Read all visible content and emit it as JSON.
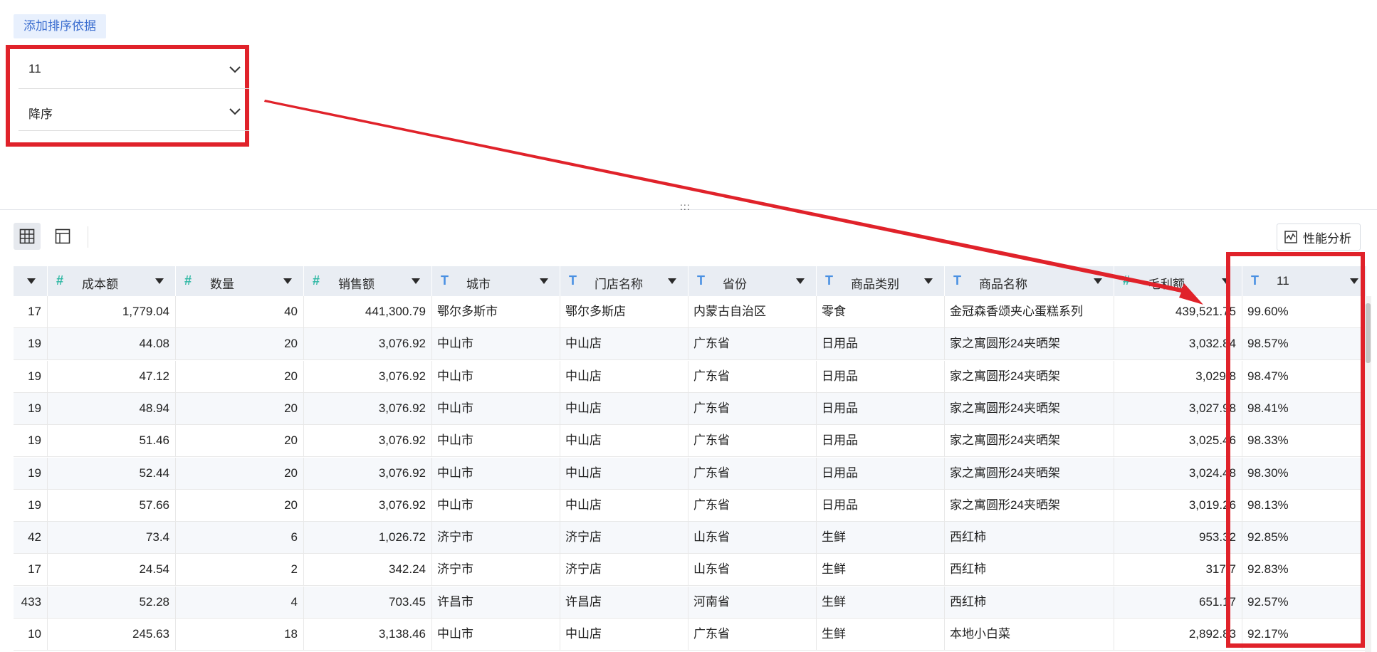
{
  "sort_panel": {
    "add_sort_label": "添加排序依据",
    "field_value": "11",
    "order_value": "降序"
  },
  "toolbar": {
    "drag_handle": ":::",
    "perf_label": "性能分析"
  },
  "table": {
    "columns": [
      {
        "label": "",
        "type": ""
      },
      {
        "label": "成本额",
        "type": "num"
      },
      {
        "label": "数量",
        "type": "num"
      },
      {
        "label": "销售额",
        "type": "num"
      },
      {
        "label": "城市",
        "type": "text"
      },
      {
        "label": "门店名称",
        "type": "text"
      },
      {
        "label": "省份",
        "type": "text"
      },
      {
        "label": "商品类别",
        "type": "text"
      },
      {
        "label": "商品名称",
        "type": "text"
      },
      {
        "label": "毛利额",
        "type": "num"
      },
      {
        "label": "11",
        "type": "text"
      }
    ],
    "type_glyphs": {
      "num": "#",
      "text": "T"
    },
    "rows": [
      [
        "17",
        "1,779.04",
        "40",
        "441,300.79",
        "鄂尔多斯市",
        "鄂尔多斯店",
        "内蒙古自治区",
        "零食",
        "金冠森香颂夹心蛋糕系列",
        "439,521.75",
        "99.60%"
      ],
      [
        "19",
        "44.08",
        "20",
        "3,076.92",
        "中山市",
        "中山店",
        "广东省",
        "日用品",
        "家之寓圆形24夹晒架",
        "3,032.84",
        "98.57%"
      ],
      [
        "19",
        "47.12",
        "20",
        "3,076.92",
        "中山市",
        "中山店",
        "广东省",
        "日用品",
        "家之寓圆形24夹晒架",
        "3,029.8",
        "98.47%"
      ],
      [
        "19",
        "48.94",
        "20",
        "3,076.92",
        "中山市",
        "中山店",
        "广东省",
        "日用品",
        "家之寓圆形24夹晒架",
        "3,027.98",
        "98.41%"
      ],
      [
        "19",
        "51.46",
        "20",
        "3,076.92",
        "中山市",
        "中山店",
        "广东省",
        "日用品",
        "家之寓圆形24夹晒架",
        "3,025.46",
        "98.33%"
      ],
      [
        "19",
        "52.44",
        "20",
        "3,076.92",
        "中山市",
        "中山店",
        "广东省",
        "日用品",
        "家之寓圆形24夹晒架",
        "3,024.48",
        "98.30%"
      ],
      [
        "19",
        "57.66",
        "20",
        "3,076.92",
        "中山市",
        "中山店",
        "广东省",
        "日用品",
        "家之寓圆形24夹晒架",
        "3,019.26",
        "98.13%"
      ],
      [
        "42",
        "73.4",
        "6",
        "1,026.72",
        "济宁市",
        "济宁店",
        "山东省",
        "生鲜",
        "西红柿",
        "953.32",
        "92.85%"
      ],
      [
        "17",
        "24.54",
        "2",
        "342.24",
        "济宁市",
        "济宁店",
        "山东省",
        "生鲜",
        "西红柿",
        "317.7",
        "92.83%"
      ],
      [
        "433",
        "52.28",
        "4",
        "703.45",
        "许昌市",
        "许昌店",
        "河南省",
        "生鲜",
        "西红柿",
        "651.17",
        "92.57%"
      ],
      [
        "10",
        "245.63",
        "18",
        "3,138.46",
        "中山市",
        "中山店",
        "广东省",
        "生鲜",
        "本地小白菜",
        "2,892.83",
        "92.17%"
      ]
    ]
  },
  "colors": {
    "annotation_red": "#e0222a",
    "header_bg": "#e9edf3",
    "accent_blue": "#3d6fd0"
  }
}
